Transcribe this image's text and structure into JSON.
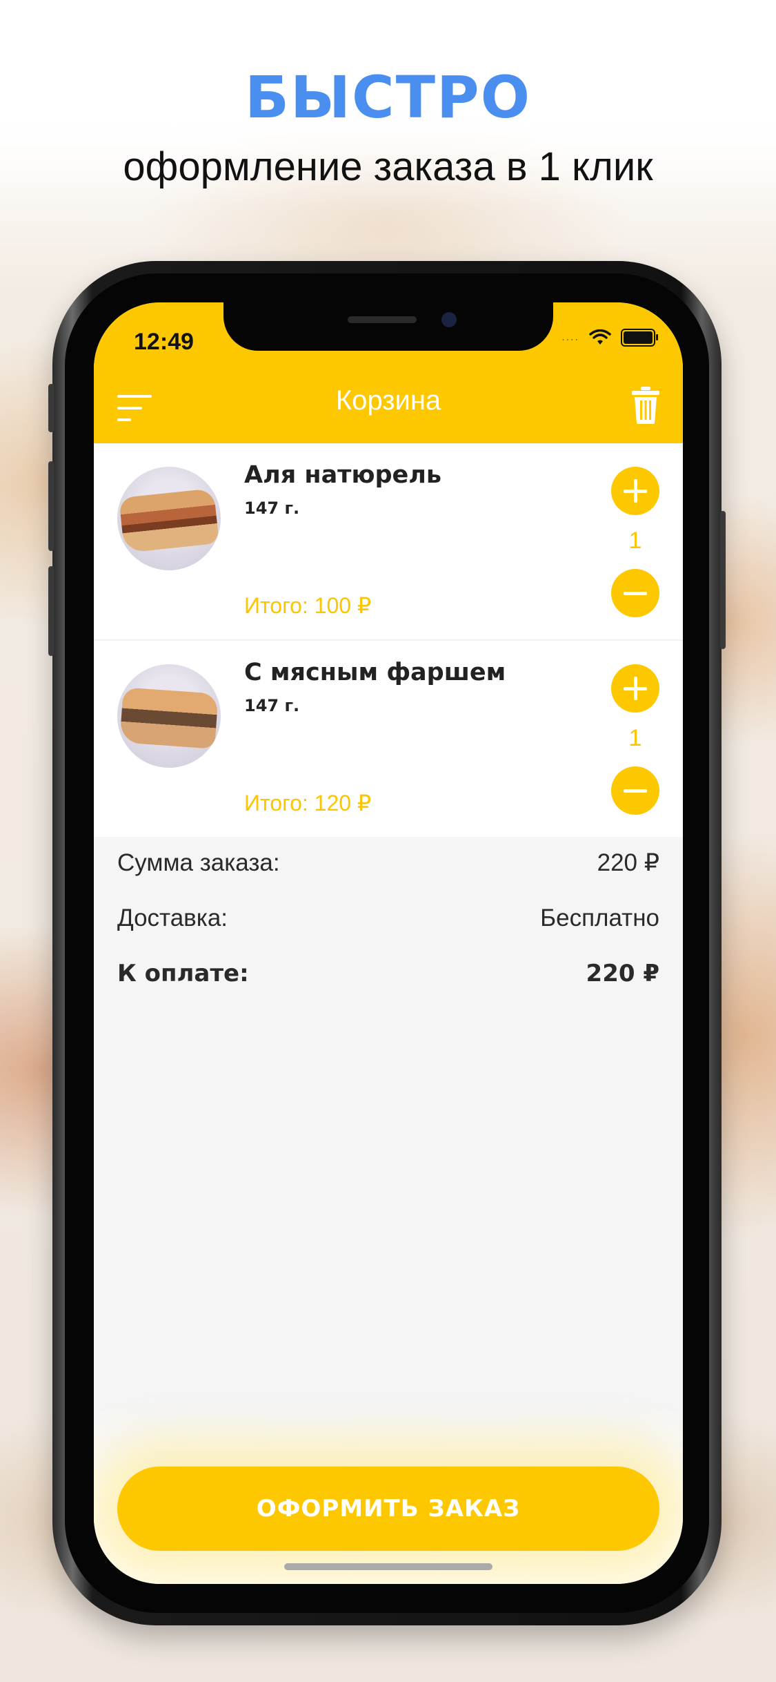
{
  "promo": {
    "headline": "БЫСТРО",
    "subline": "оформление заказа в 1 клик"
  },
  "status_bar": {
    "time": "12:49",
    "signal_dots": "....",
    "icons": [
      "wifi-icon",
      "battery-icon"
    ]
  },
  "header": {
    "title": "Корзина",
    "menu_icon": "menu-icon",
    "delete_icon": "trash-icon"
  },
  "cart": {
    "items": [
      {
        "name": "Аля натюрель",
        "weight": "147 г.",
        "total": "Итого: 100 ₽",
        "quantity": "1"
      },
      {
        "name": "С мясным фаршем",
        "weight": "147 г.",
        "total": "Итого: 120 ₽",
        "quantity": "1"
      }
    ]
  },
  "summary": {
    "subtotal_label": "Сумма заказа:",
    "subtotal_value": "220 ₽",
    "delivery_label": "Доставка:",
    "delivery_value": "Бесплатно",
    "total_label": "К оплате:",
    "total_value": "220 ₽"
  },
  "actions": {
    "checkout_label": "ОФОРМИТЬ ЗАКАЗ"
  },
  "colors": {
    "accent": "#fdc800",
    "headline": "#4a8ff0",
    "price": "#fdc400"
  }
}
